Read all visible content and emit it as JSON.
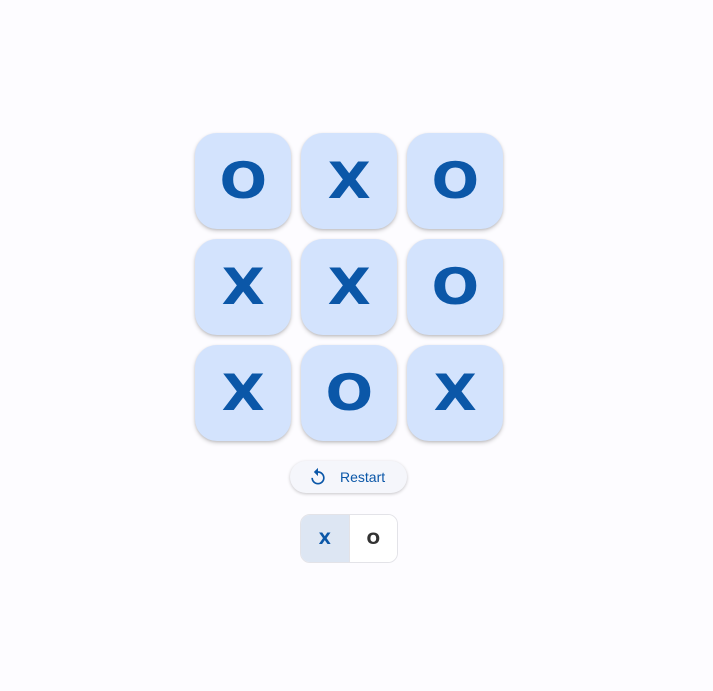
{
  "board": {
    "cells": [
      "O",
      "X",
      "O",
      "X",
      "X",
      "O",
      "X",
      "O",
      "X"
    ]
  },
  "restart": {
    "label": "Restart",
    "icon": "restart-icon"
  },
  "player_toggle": {
    "options": [
      "X",
      "O"
    ],
    "selected": "X"
  },
  "colors": {
    "background": "#fdfcff",
    "cell": "#d3e3fd",
    "mark": "#0b57a8",
    "selected_segment": "#dde6f3"
  }
}
